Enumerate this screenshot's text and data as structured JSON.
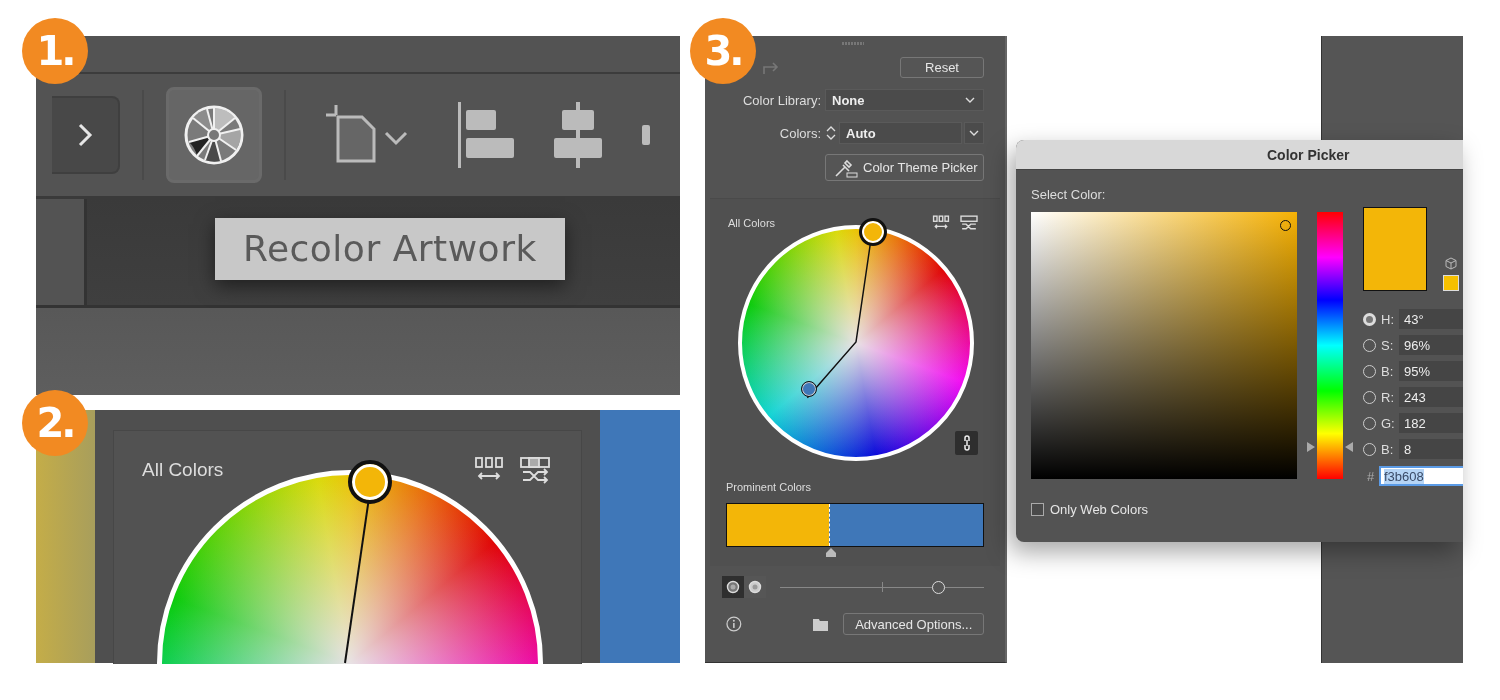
{
  "steps": [
    {
      "label": "1."
    },
    {
      "label": "2."
    },
    {
      "label": "3."
    }
  ],
  "panel1": {
    "tooltip": "Recolor Artwork"
  },
  "panel2": {
    "wheel_label": "All Colors"
  },
  "panel3": {
    "reset": "Reset",
    "color_library": {
      "label": "Color Library:",
      "value": "None"
    },
    "colors": {
      "label": "Colors:",
      "value": "Auto"
    },
    "theme_picker": "Color Theme Picker",
    "wheel_label": "All Colors",
    "prominent": {
      "label": "Prominent Colors",
      "segments": [
        {
          "color": "#f3b608",
          "level": 0.4
        },
        {
          "color": "#3f77b8",
          "level": 0.6
        }
      ]
    },
    "view_modes": [
      {
        "selected": true
      },
      {
        "selected": false
      }
    ],
    "slider": {
      "level": 0.78
    },
    "advanced": "Advanced Options..."
  },
  "color_picker": {
    "title": "Color Picker",
    "select_label": "Select Color:",
    "fields": [
      {
        "label": "H:",
        "value": "43°",
        "selected": true
      },
      {
        "label": "S:",
        "value": "96%",
        "selected": false
      },
      {
        "label": "B:",
        "value": "95%",
        "selected": false
      },
      {
        "label": "R:",
        "value": "243",
        "selected": false
      },
      {
        "label": "G:",
        "value": "182",
        "selected": false
      },
      {
        "label": "B:",
        "value": "8",
        "selected": false
      }
    ],
    "hue_slider": {
      "level": 0.12
    },
    "hex_label": "#",
    "hex": "f3b608",
    "only_web": {
      "label": "Only Web Colors",
      "checked": false
    }
  }
}
